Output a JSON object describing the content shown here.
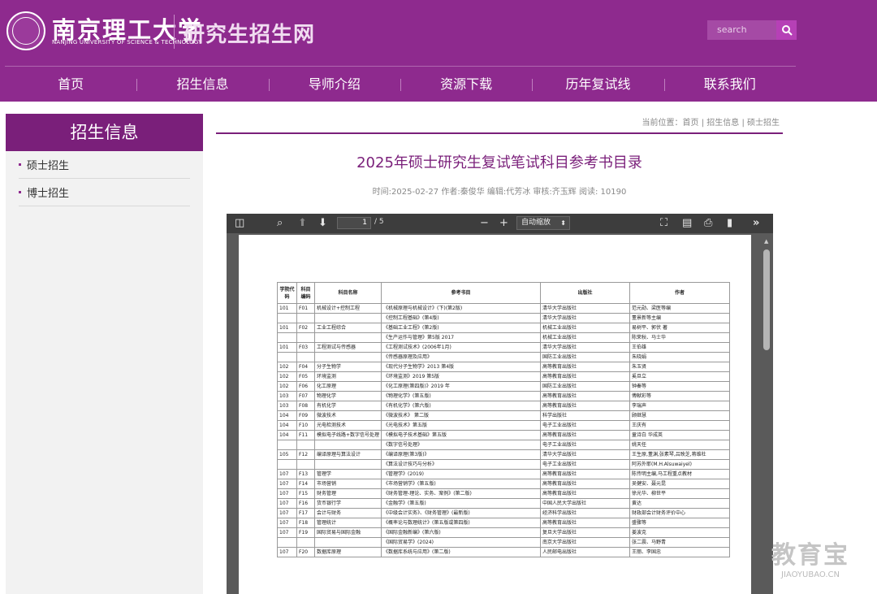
{
  "header": {
    "school_cn": "南京理工大学",
    "school_en": "NANJING UNIVERSITY OF SCIENCE & TECHNOLOGY",
    "site_title": "研究生招生网",
    "search_placeholder": "search"
  },
  "nav": [
    "首页",
    "招生信息",
    "导师介绍",
    "资源下载",
    "历年复试线",
    "联系我们"
  ],
  "sidebar": {
    "title": "招生信息",
    "items": [
      "硕士招生",
      "博士招生"
    ]
  },
  "breadcrumb": "当前位置：首页 | 招生信息 | 硕士招生",
  "article": {
    "title": "2025年硕士研究生复试笔试科目参考书目录",
    "meta": "时间:2025-02-27   作者:秦俊华   编辑:代芳冰   审核:齐玉辉   阅读: 10190"
  },
  "pdf": {
    "page": "1",
    "total": "/ 5",
    "zoom": "自动缩放",
    "headers": [
      "学院代码",
      "科目编码",
      "科目名称",
      "参考书目",
      "出版社",
      "作者"
    ],
    "rows": [
      [
        "101",
        "F01",
        "机械设计+控制工程",
        "《机械原理与机械设计》(下)(第2版)",
        "清华大学出版社",
        "范元勋、梁医等编"
      ],
      [
        "",
        "",
        "",
        "《控制工程基础》(第4版)",
        "清华大学出版社",
        "董景新等主编"
      ],
      [
        "101",
        "F02",
        "工业工程综合",
        "《基础工业工程》(第2版)",
        "机械工业出版社",
        "易树平、郭伏 著"
      ],
      [
        "",
        "",
        "",
        "《生产运作与管理》第5版 2017",
        "机械工业出版社",
        "陈荣秋、马士华"
      ],
      [
        "101",
        "F03",
        "工程测试与传感器",
        "《工程测试技术》(2006年1月)",
        "清华大学出版社",
        "王伯雄"
      ],
      [
        "",
        "",
        "",
        "《传感器原理及应用》",
        "国防工业出版社",
        "朱晓娟"
      ],
      [
        "102",
        "F04",
        "分子生物学",
        "《现代分子生物学》2013 第4版",
        "高等教育出版社",
        "朱玉贤"
      ],
      [
        "102",
        "F05",
        "环境监测",
        "《环境监测》2019 第5版",
        "高等教育出版社",
        "奚旦立"
      ],
      [
        "102",
        "F06",
        "化工原理",
        "《化工原理(第四版)》2019 年",
        "国防工业出版社",
        "钟秦等"
      ],
      [
        "103",
        "F07",
        "物理化学",
        "《物理化学》(第五版)",
        "高等教育出版社",
        "傅献彩等"
      ],
      [
        "103",
        "F08",
        "有机化学",
        "《有机化学》(第六版)",
        "高等教育出版社",
        "李瑞声"
      ],
      [
        "104",
        "F09",
        "微波技术",
        "《微波技术》 第二版",
        "科学出版社",
        "顾继慧"
      ],
      [
        "104",
        "F10",
        "光电检测技术",
        "《光电技术》第五版",
        "电子工业出版社",
        "王庆有"
      ],
      [
        "104",
        "F11",
        "模拟电子线路+数字信号处理",
        "《模拟电子技术基础》第五版",
        "高等教育出版社",
        "童诗白 华成英"
      ],
      [
        "",
        "",
        "",
        "《数字信号处理》",
        "电子工业出版社",
        "姚天任"
      ],
      [
        "105",
        "F12",
        "编译原理与算法设计",
        "《编译原理(第3版)》",
        "清华大学出版社",
        "王生原,董渊,张素琴,吕映芝,蒋维杜"
      ],
      [
        "",
        "",
        "",
        "《算法设计技巧与分析》",
        "电子工业出版社",
        "阿苏外耶(M.H.Alsuwaiyel)"
      ],
      [
        "107",
        "F13",
        "管理学",
        "《管理学》(2019)",
        "高等教育出版社",
        "陈传明主编,马工程重点教材"
      ],
      [
        "107",
        "F14",
        "市场营销",
        "《市场营销学》(第五版)",
        "高等教育出版社",
        "吴健安、聂元昆"
      ],
      [
        "107",
        "F15",
        "财务管理",
        "《财务管理-理论、实务、案例》(第二版)",
        "高等教育出版社",
        "徐光华、柳世平"
      ],
      [
        "107",
        "F16",
        "货币银行学",
        "《金融学》(第五版)",
        "中国人民大学出版社",
        "黄达"
      ],
      [
        "107",
        "F17",
        "会计与财务",
        "《中级会计实务》、《财务管理》(最新版)",
        "经济科学出版社",
        "财政部会计财务评价中心"
      ],
      [
        "107",
        "F18",
        "管理统计",
        "《概率论与数理统计》(第五版或第四版)",
        "高等教育出版社",
        "盛骤等"
      ],
      [
        "107",
        "F19",
        "国际贸易与国际金融",
        "《国际金融新编》(第六版)",
        "复旦大学出版社",
        "姜波克"
      ],
      [
        "",
        "",
        "",
        "《国际贸易学》(2024)",
        "南京大学出版社",
        "张二震、马野青"
      ],
      [
        "107",
        "F20",
        "数据库原理",
        "《数据库系统与应用》(第二版)",
        "人民邮电出版社",
        "王丽、李国忠"
      ]
    ]
  },
  "watermark": {
    "big": "教育宝",
    "small": "JIAOYUBAO.CN"
  }
}
